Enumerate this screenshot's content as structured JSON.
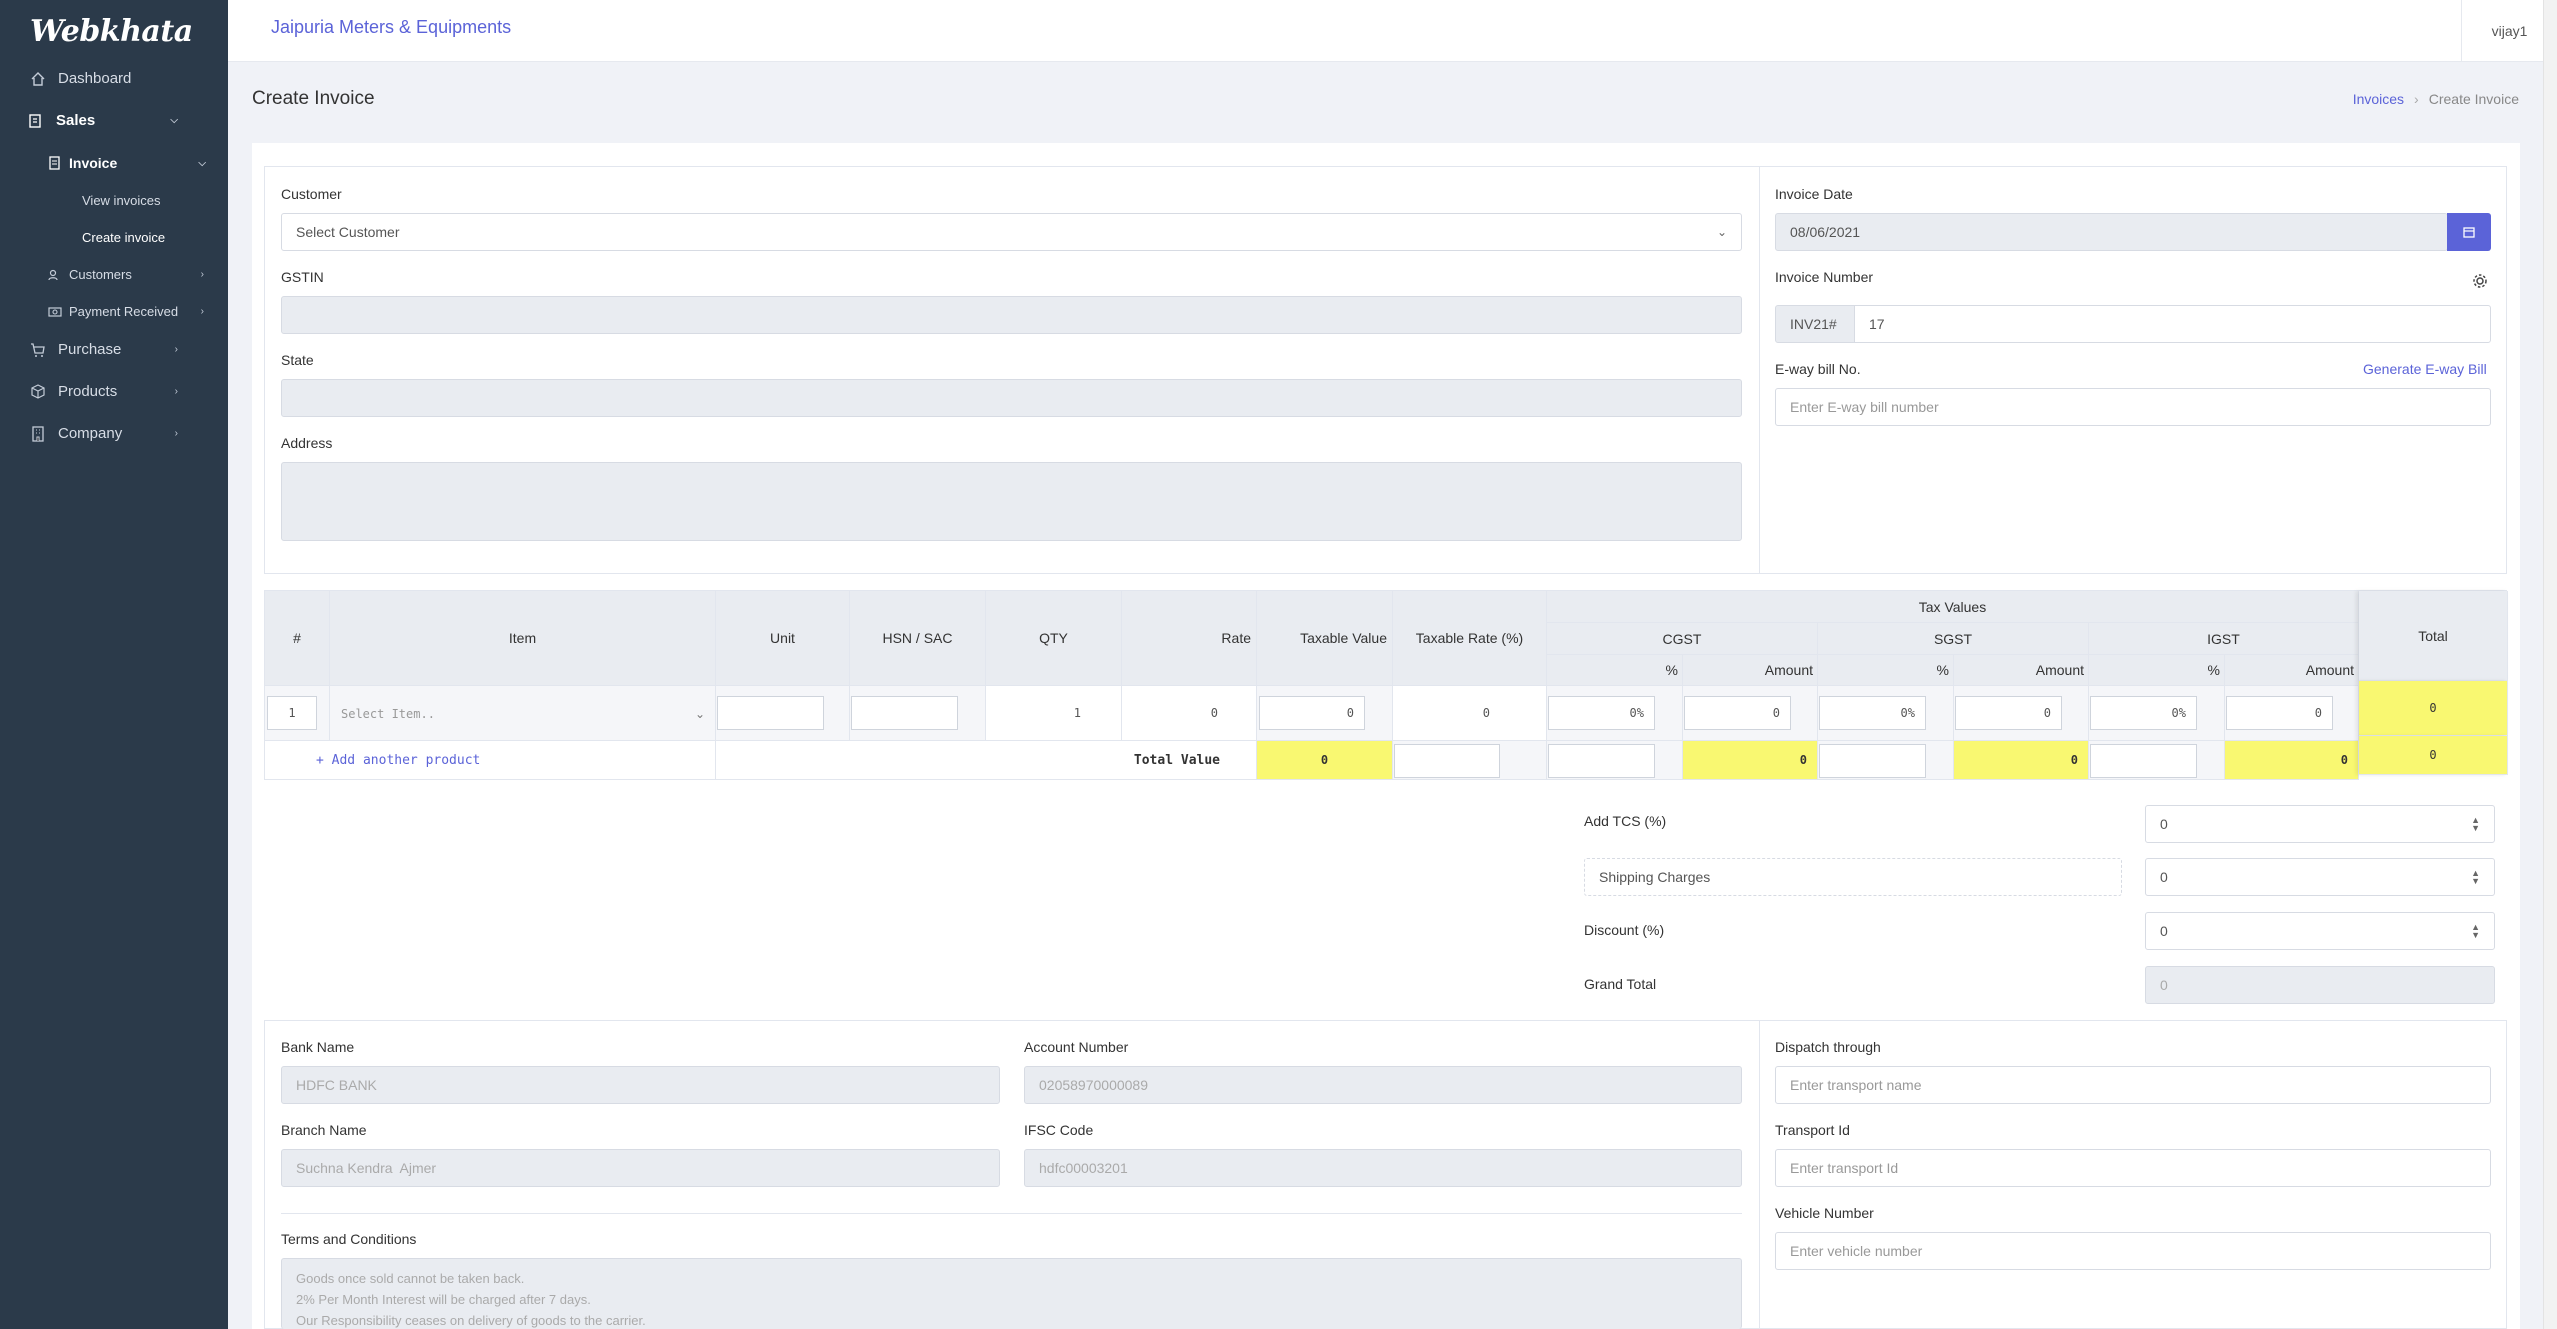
{
  "app": {
    "logo": "Webkhata",
    "company": "Jaipuria Meters & Equipments",
    "user": "vijay1"
  },
  "sidebar": {
    "dashboard": "Dashboard",
    "sales": "Sales",
    "invoice": "Invoice",
    "view_invoices": "View invoices",
    "create_invoice": "Create invoice",
    "customers": "Customers",
    "payment_received": "Payment Received",
    "purchase": "Purchase",
    "products": "Products",
    "company": "Company"
  },
  "page": {
    "title": "Create Invoice",
    "breadcrumb_link": "Invoices",
    "breadcrumb_current": "Create Invoice"
  },
  "customer": {
    "label": "Customer",
    "select_placeholder": "Select Customer",
    "gstin_label": "GSTIN",
    "state_label": "State",
    "address_label": "Address"
  },
  "invoice": {
    "date_label": "Invoice Date",
    "date_value": "08/06/2021",
    "number_label": "Invoice Number",
    "prefix": "INV21#",
    "number_value": "17",
    "eway_label": "E-way bill No.",
    "eway_link": "Generate E-way Bill",
    "eway_placeholder": "Enter E-way bill number"
  },
  "table": {
    "headers": {
      "num": "#",
      "item": "Item",
      "unit": "Unit",
      "hsn": "HSN / SAC",
      "qty": "QTY",
      "rate": "Rate",
      "taxable_value": "Taxable Value",
      "taxable_rate": "Taxable Rate (%)",
      "tax_values": "Tax Values",
      "cgst": "CGST",
      "sgst": "SGST",
      "igst": "IGST",
      "pct": "%",
      "amount": "Amount",
      "total": "Total"
    },
    "row": {
      "num": "1",
      "item_placeholder": "Select Item..",
      "qty": "1",
      "rate": "0",
      "taxable_value": "0",
      "taxable_rate": "0",
      "cgst_pct": "0%",
      "cgst_amt": "0",
      "sgst_pct": "0%",
      "sgst_amt": "0",
      "igst_pct": "0%",
      "igst_amt": "0",
      "total": "0"
    },
    "add_product": "+ Add another product",
    "total_label": "Total Value",
    "totals": {
      "taxable_value": "0",
      "cgst_amt": "0",
      "sgst_amt": "0",
      "igst_amt": "0",
      "total": "0"
    }
  },
  "summary": {
    "tcs_label": "Add TCS (%)",
    "tcs_value": "0",
    "shipping_label": "Shipping Charges",
    "shipping_value": "0",
    "discount_label": "Discount (%)",
    "discount_value": "0",
    "grand_total_label": "Grand Total",
    "grand_total_value": "0"
  },
  "bank": {
    "bank_name_label": "Bank Name",
    "bank_name": "HDFC BANK",
    "account_label": "Account Number",
    "account": "02058970000089",
    "branch_label": "Branch Name",
    "branch": "Suchna Kendra  Ajmer",
    "ifsc_label": "IFSC Code",
    "ifsc": "hdfc00003201",
    "terms_label": "Terms and Conditions",
    "terms_line1": "Goods once sold cannot be taken back.",
    "terms_line2": "2% Per Month Interest will be charged after 7 days.",
    "terms_line3": "Our Responsibility ceases on delivery of goods to the carrier."
  },
  "transport": {
    "dispatch_label": "Dispatch through",
    "dispatch_placeholder": "Enter transport name",
    "transport_id_label": "Transport Id",
    "transport_id_placeholder": "Enter transport Id",
    "vehicle_label": "Vehicle Number",
    "vehicle_placeholder": "Enter vehicle number"
  }
}
